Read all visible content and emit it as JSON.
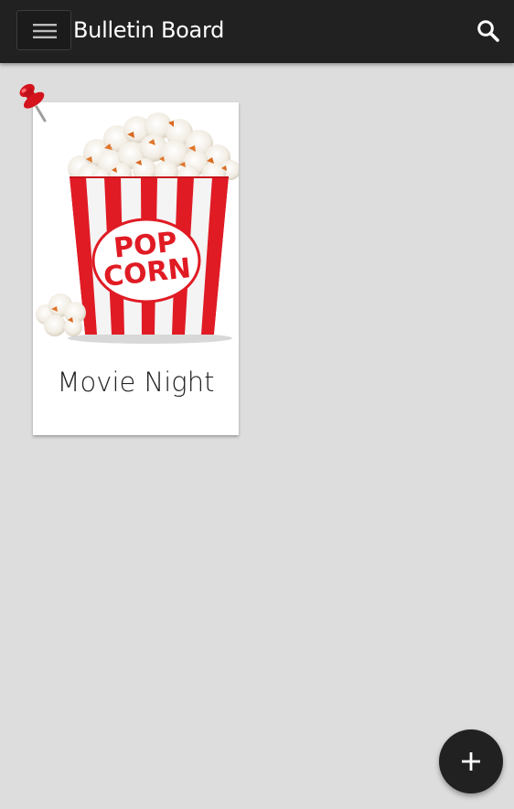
{
  "header": {
    "title": "Bulletin Board",
    "menu_icon": "hamburger-menu-icon",
    "search_icon": "search-icon"
  },
  "board": {
    "cards": [
      {
        "title": "Movie Night",
        "image": "popcorn-bucket-image",
        "image_text": [
          "POP",
          "CORN"
        ],
        "pinned": true,
        "pin_icon": "pushpin-icon"
      }
    ]
  },
  "fab": {
    "icon": "plus-icon"
  },
  "colors": {
    "topbar": "#212121",
    "background": "#dddddd",
    "card": "#ffffff",
    "popcorn_red": "#e01b24",
    "fab": "#212121"
  }
}
